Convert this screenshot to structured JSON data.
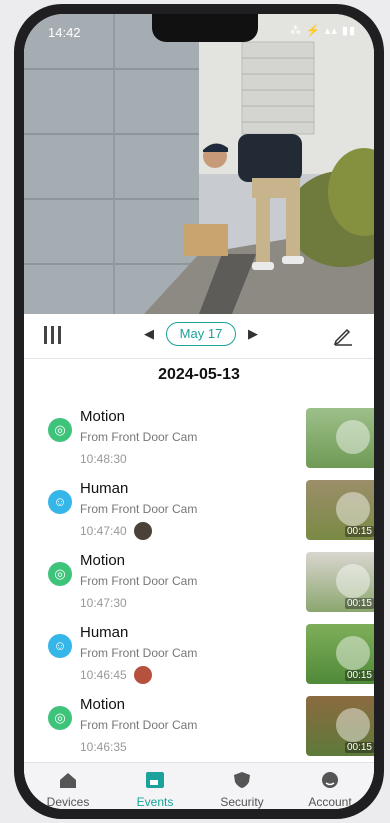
{
  "status": {
    "time": "14:42",
    "icons": "⁂ ⚡ ▴▴ ▮▮"
  },
  "toolbar": {
    "prev": "◀",
    "date": "May 17",
    "next": "▶"
  },
  "day_header": "2024-05-13",
  "events": [
    {
      "type": "Motion",
      "source": "From Front Door Cam",
      "time": "10:48:30",
      "icon": "motion",
      "color": "#3ec47a",
      "duration": "",
      "has_avatar": false
    },
    {
      "type": "Human",
      "source": "From Front Door Cam",
      "time": "10:47:40",
      "icon": "human",
      "color": "#35b6e8",
      "duration": "00:15",
      "has_avatar": true
    },
    {
      "type": "Motion",
      "source": "From Front Door Cam",
      "time": "10:47:30",
      "icon": "motion",
      "color": "#3ec47a",
      "duration": "00:15",
      "has_avatar": false
    },
    {
      "type": "Human",
      "source": "From Front Door Cam",
      "time": "10:46:45",
      "icon": "human",
      "color": "#35b6e8",
      "duration": "00:15",
      "has_avatar": true
    },
    {
      "type": "Motion",
      "source": "From Front Door Cam",
      "time": "10:46:35",
      "icon": "motion",
      "color": "#3ec47a",
      "duration": "00:15",
      "has_avatar": false
    }
  ],
  "tabs": [
    {
      "label": "Devices",
      "icon": "house",
      "active": false
    },
    {
      "label": "Events",
      "icon": "events-grid",
      "active": true
    },
    {
      "label": "Security",
      "icon": "shield",
      "active": false
    },
    {
      "label": "Account",
      "icon": "user",
      "active": false
    }
  ],
  "accent": "#1ba29a"
}
